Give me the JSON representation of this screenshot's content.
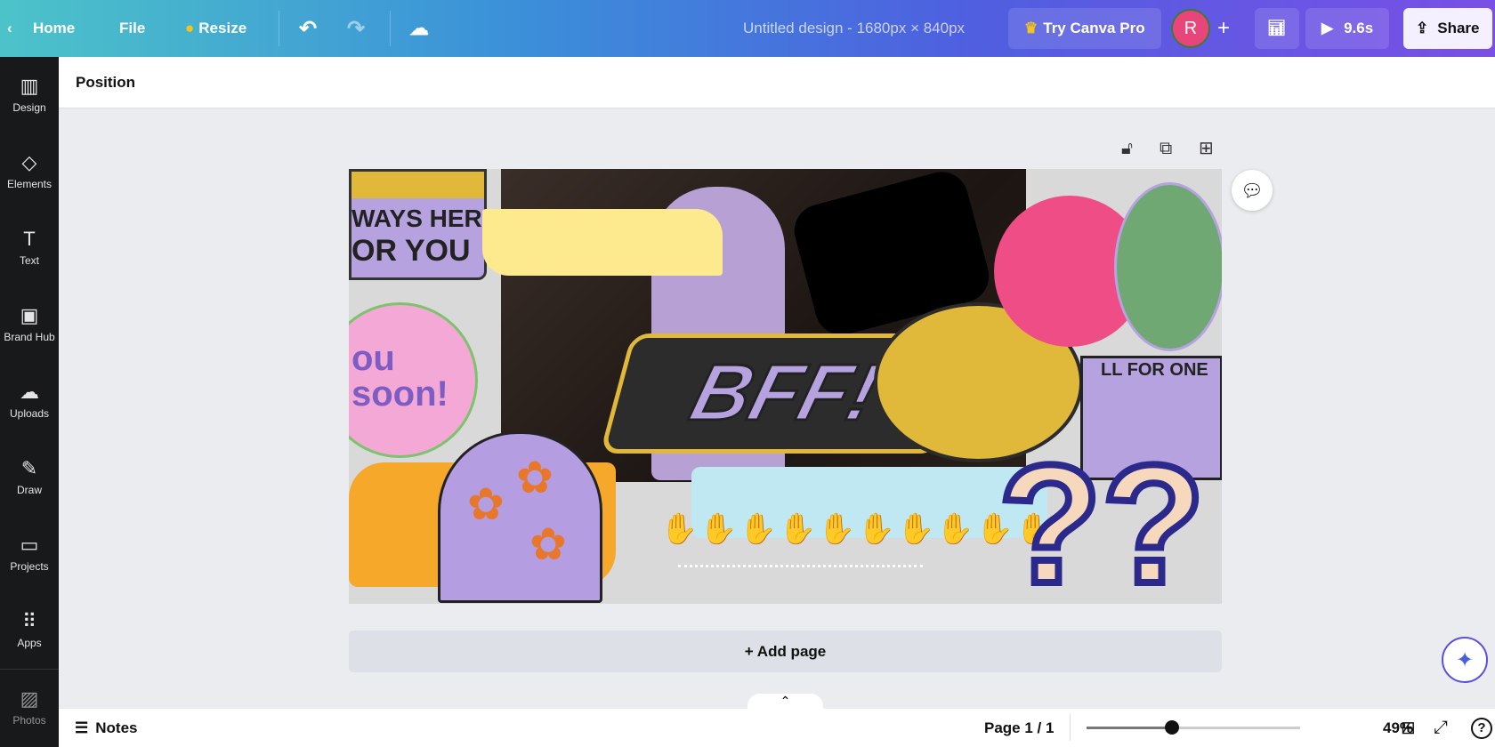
{
  "topbar": {
    "home": "Home",
    "file": "File",
    "resize": "Resize",
    "title": "Untitled design - 1680px × 840px",
    "try_pro": "Try Canva Pro",
    "avatar": "R",
    "play_time": "9.6s",
    "share": "Share"
  },
  "sidebar": [
    {
      "label": "Design",
      "icon": "▥"
    },
    {
      "label": "Elements",
      "icon": "◇"
    },
    {
      "label": "Text",
      "icon": "T"
    },
    {
      "label": "Brand Hub",
      "icon": "▣"
    },
    {
      "label": "Uploads",
      "icon": "☁"
    },
    {
      "label": "Draw",
      "icon": "✎"
    },
    {
      "label": "Projects",
      "icon": "▭"
    },
    {
      "label": "Apps",
      "icon": "⠿"
    },
    {
      "label": "Photos",
      "icon": "▨"
    }
  ],
  "toolbar": {
    "position": "Position"
  },
  "design": {
    "text1": "WAYS HERE",
    "text2": "OR YOU",
    "text3": "BFF!",
    "text4": "LL FOR ONE",
    "text5": "ou",
    "text6": "soon!"
  },
  "add_page": "+ Add page",
  "bottom": {
    "notes": "Notes",
    "page": "Page 1 / 1",
    "zoom": "49%",
    "zoom_value": 49
  },
  "colors": {
    "accent": "#7d2ae8"
  }
}
